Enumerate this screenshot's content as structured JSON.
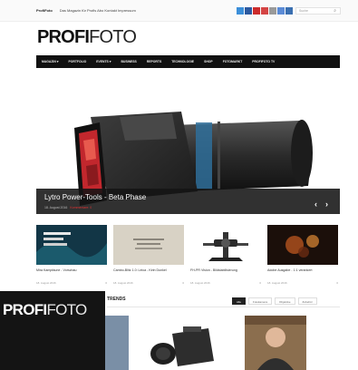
{
  "topbar": {
    "site_name": "ProfiFoto",
    "tagline": "Das Magazin für Profis   Abo   Kontakt   Impressum",
    "search_placeholder": "Suche",
    "social_colors": [
      "#3b8fd9",
      "#2c5aa0",
      "#cc2b2b",
      "#d44444",
      "#9a9a9a",
      "#5b8bd6",
      "#3a6fb0"
    ]
  },
  "logo": {
    "bold": "PROFI",
    "regular": "FOTO"
  },
  "nav": {
    "items": [
      "MAGAZIN ▾",
      "PORTFOLIO",
      "EVENTS ▾",
      "BUSINESS",
      "REPORTS",
      "TECHNOLOGIE",
      "SHOP",
      "FOTOMARKT",
      "PROFIFOTO TV"
    ]
  },
  "hero": {
    "title": "Lytro Power-Tools - Beta Phase",
    "meta": "18. August 2016",
    "meta_tag": "Kommentare: 0",
    "prev": "‹",
    "next": "›"
  },
  "thumbs": [
    {
      "caption": "Mira Kampfaune - Vorschau",
      "date": "18. August 2016",
      "count": "0"
    },
    {
      "caption": "Cambo-Blitz 1.0: Leica - Kein Dunkel",
      "date": "18. August 2016",
      "count": "0"
    },
    {
      "caption": "FH-PR Vision - Bildstabilisierung",
      "date": "18. August 2016",
      "count": "0"
    },
    {
      "caption": "Adobe Ausgabe - 1:1 verankert",
      "date": "18. August 2016",
      "count": "0"
    }
  ],
  "section": {
    "title": "TRENDS",
    "tabs": [
      "Alle",
      "Fotokamera",
      "Objektive",
      "Zubehör"
    ]
  },
  "magazine": {
    "bold": "PROFI",
    "regular": "FOTO"
  }
}
